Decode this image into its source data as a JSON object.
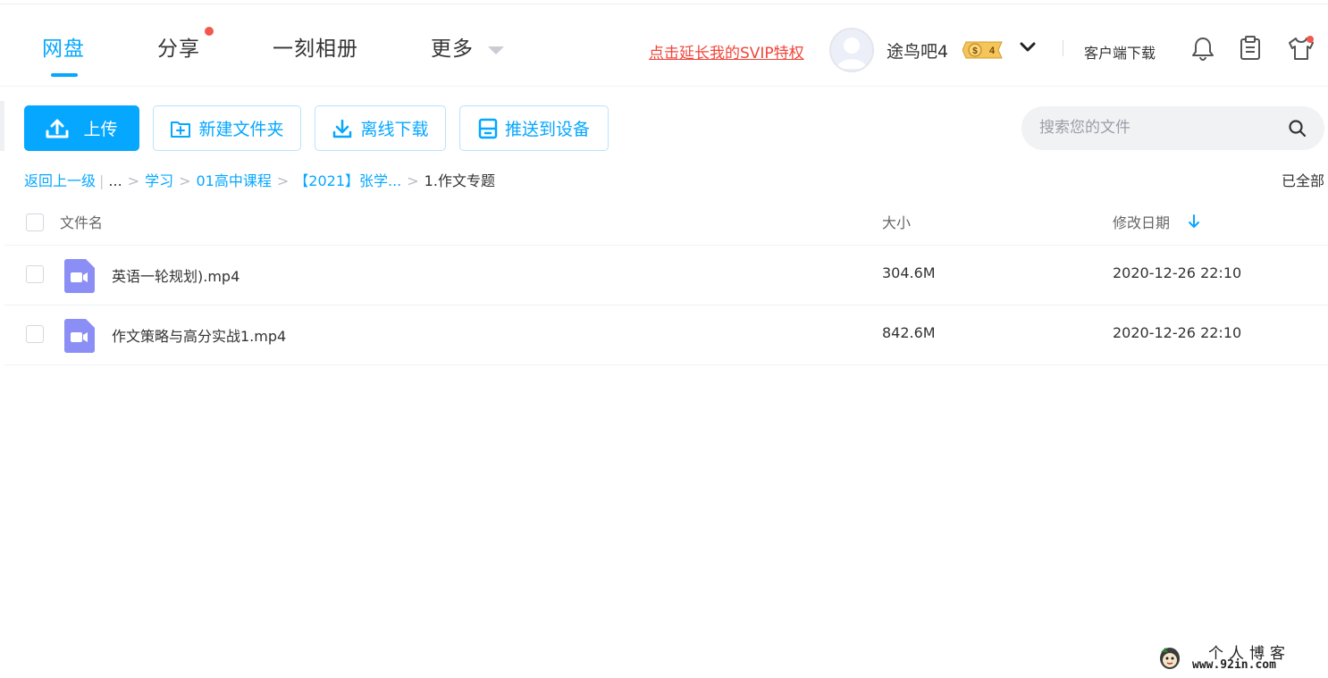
{
  "nav": {
    "tabs": [
      {
        "label": "网盘",
        "active": true
      },
      {
        "label": "分享",
        "has_dot": true
      },
      {
        "label": "一刻相册"
      },
      {
        "label": "更多"
      }
    ],
    "svip_link": "点击延长我的SVIP特权",
    "username": "途鸟吧4",
    "vip_level": "4",
    "client_download": "客户端下载",
    "icons": [
      "bell-icon",
      "clipboard-icon",
      "shirt-icon"
    ]
  },
  "toolbar": {
    "upload": "上传",
    "new_folder": "新建文件夹",
    "offline_download": "离线下载",
    "push_device": "推送到设备"
  },
  "search": {
    "placeholder": "搜索您的文件"
  },
  "breadcrumb": {
    "back": "返回上一级",
    "ellipsis": "...",
    "items": [
      "学习",
      "01高中课程",
      "【2021】张学..."
    ],
    "current": "1.作文专题",
    "status": "已全部"
  },
  "table": {
    "columns": {
      "name": "文件名",
      "size": "大小",
      "date": "修改日期"
    },
    "rows": [
      {
        "name": "英语一轮规划).mp4",
        "size": "304.6M",
        "date": "2020-12-26 22:10"
      },
      {
        "name": "作文策略与高分实战1.mp4",
        "size": "842.6M",
        "date": "2020-12-26 22:10"
      }
    ]
  },
  "watermark": {
    "title": "个人博客",
    "url": "www.92in.com"
  },
  "colors": {
    "accent": "#06a7ff",
    "svip_red": "#f0453a",
    "video_icon": "#8b8ff5"
  }
}
